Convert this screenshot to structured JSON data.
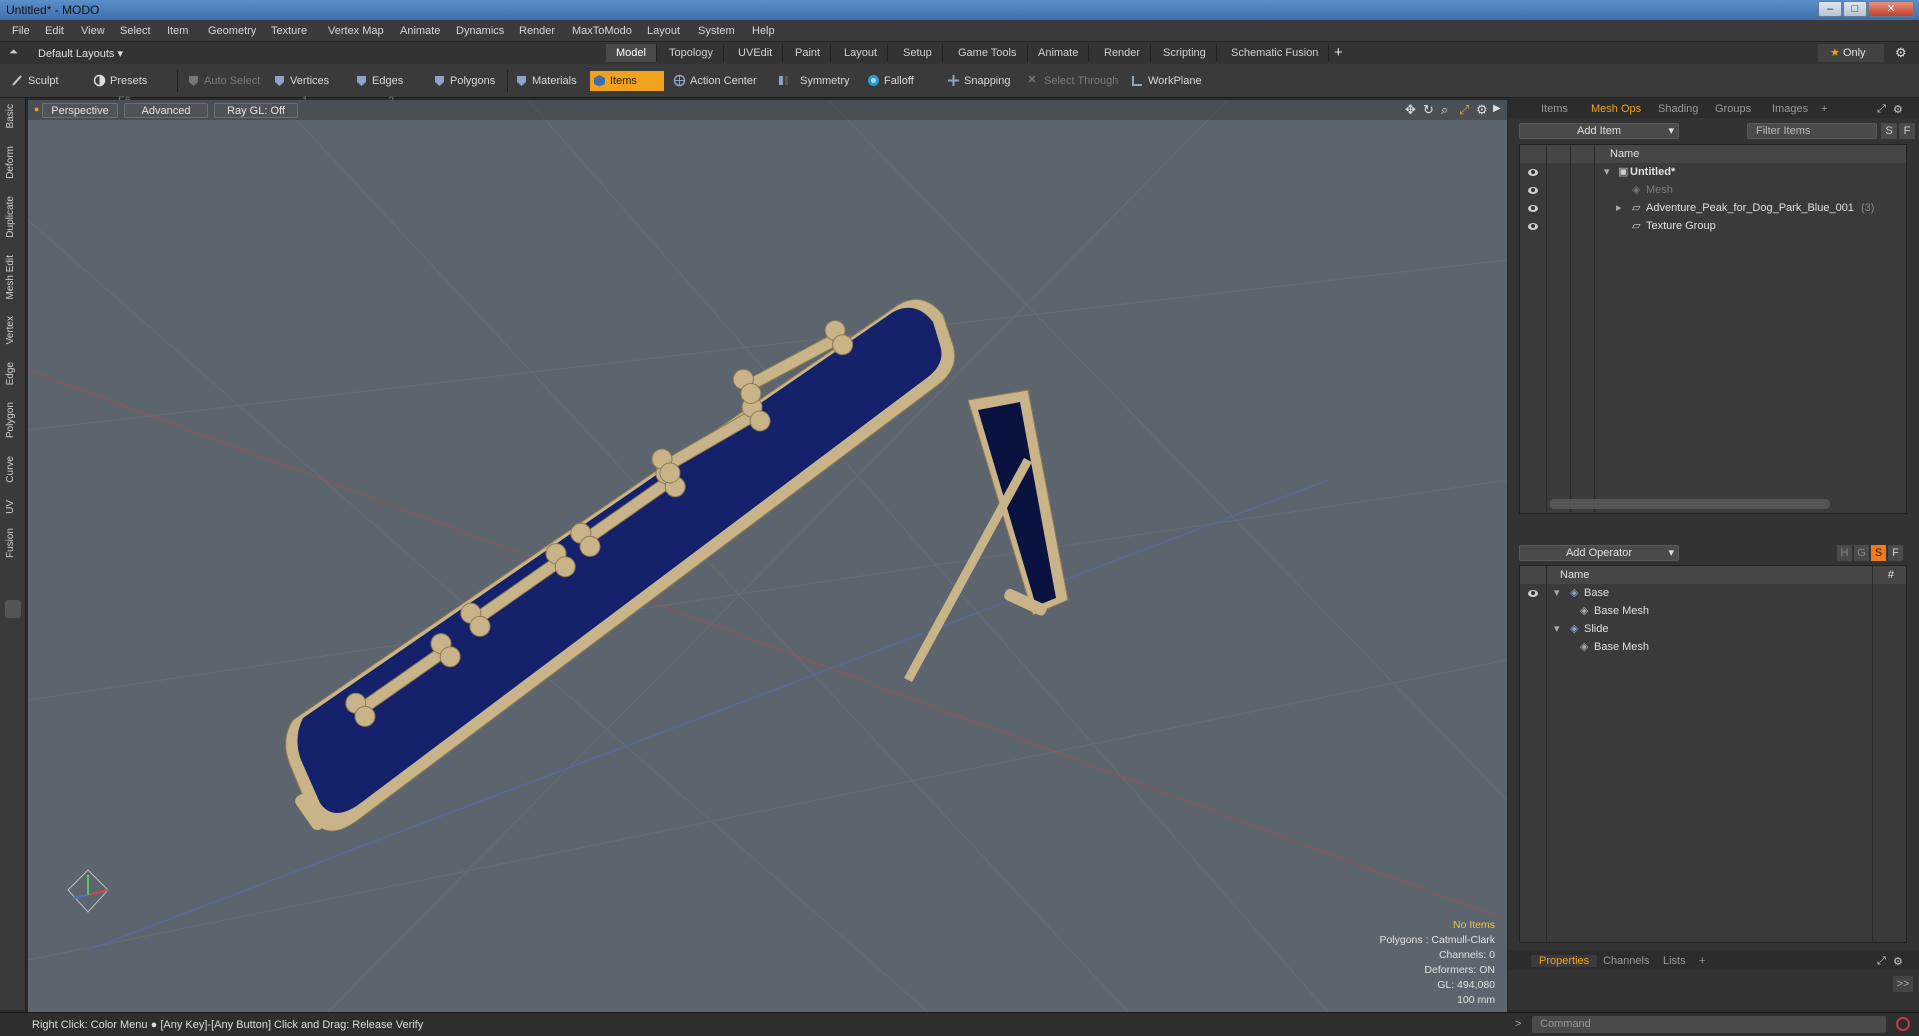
{
  "window": {
    "title": "Untitled* - MODO",
    "controls": [
      "minimize-icon",
      "maximize-icon",
      "close-icon"
    ]
  },
  "menu": [
    "File",
    "Edit",
    "View",
    "Select",
    "Item",
    "Geometry",
    "Texture",
    "Vertex Map",
    "Animate",
    "Dynamics",
    "Render",
    "MaxToModo",
    "Layout",
    "System",
    "Help"
  ],
  "layoutbar": {
    "preset": "Default Layouts",
    "tabs": [
      "Model",
      "Topology",
      "UVEdit",
      "Paint",
      "Layout",
      "Setup",
      "Game Tools",
      "Animate",
      "Render",
      "Scripting",
      "Schematic Fusion"
    ],
    "active_tab": "Model",
    "add": "+",
    "only": "Only"
  },
  "toolbar": {
    "sculpt": "Sculpt",
    "presets": "Presets",
    "presets_key": "F6",
    "auto_select": "Auto Select",
    "vertices": "Vertices",
    "vertices_n": "1",
    "edges": "Edges",
    "edges_n": "2",
    "polygons": "Polygons",
    "materials": "Materials",
    "items": "Items",
    "action_center": "Action Center",
    "symmetry": "Symmetry",
    "falloff": "Falloff",
    "snapping": "Snapping",
    "select_through": "Select Through",
    "workplane": "WorkPlane"
  },
  "left_tabs": [
    "Basic",
    "Deform",
    "Duplicate",
    "Mesh Edit",
    "Vertex",
    "Edge",
    "Polygon",
    "Curve",
    "UV",
    "Fusion"
  ],
  "viewport": {
    "view": "Perspective",
    "shading": "Advanced",
    "raygl": "Ray GL: Off",
    "info": {
      "no_items": "No Items",
      "polygons": "Polygons : Catmull-Clark",
      "channels": "Channels: 0",
      "deformers": "Deformers: ON",
      "gl": "GL: 494,080",
      "scale": "100 mm"
    },
    "axes": {
      "x": "x",
      "y": "y",
      "z": "z"
    }
  },
  "items_panel": {
    "tabs": [
      "Items",
      "Mesh Ops",
      "Shading",
      "Groups",
      "Images"
    ],
    "active_tab": "Mesh Ops",
    "add_item": "Add Item",
    "filter": "Filter Items",
    "s": "S",
    "f": "F",
    "col_name": "Name",
    "tree": [
      {
        "label": "Untitled*"
      },
      {
        "label": "Mesh"
      },
      {
        "label": "Adventure_Peak_for_Dog_Park_Blue_001",
        "count": "(3)"
      },
      {
        "label": "Texture Group"
      }
    ]
  },
  "meshops_panel": {
    "add_operator": "Add Operator",
    "h": "H",
    "g": "G",
    "s": "S",
    "f": "F",
    "col_name": "Name",
    "col_hash": "#",
    "tree": [
      {
        "label": "Base"
      },
      {
        "label": "Base Mesh"
      },
      {
        "label": "Slide"
      },
      {
        "label": "Base Mesh"
      }
    ]
  },
  "properties_panel": {
    "tabs": [
      "Properties",
      "Channels",
      "Lists"
    ],
    "active_tab": "Properties",
    "expand": ">>"
  },
  "status": {
    "hint": "Right Click: Color Menu",
    "hint2": "[Any Key]-[Any Button] Click and Drag: Release Verify",
    "command_placeholder": "Command"
  },
  "colors": {
    "accent": "#f0a21c",
    "ramp_blue": "#15216b",
    "wood": "#c9b48a",
    "viewport_bg": "#5c656d"
  }
}
